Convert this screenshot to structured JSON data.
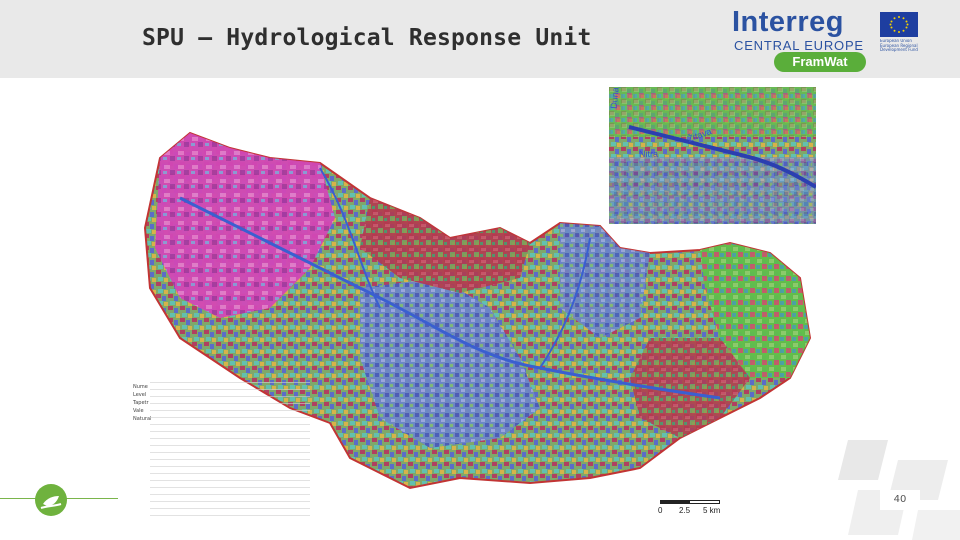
{
  "slide": {
    "title": "SPU – Hydrological Response Unit",
    "page_number": "40"
  },
  "logo": {
    "brand": "Interreg",
    "region": "CENTRAL EUROPE",
    "project": "FramWat",
    "fund_text": "European Union European Regional Development Fund"
  },
  "inset_labels": [
    "Dunaj",
    "Žitava",
    "Nitra"
  ],
  "legend_head": [
    "Nume",
    "Level",
    "Tapetr",
    "Vale",
    "Natural"
  ],
  "scale": {
    "ticks": [
      "0",
      "2.5",
      "5 km"
    ]
  },
  "colors": {
    "header_bg": "#e9e9e9",
    "brand_blue": "#2b52a1",
    "project_green": "#5aae3a",
    "map_magenta": "#d946b8",
    "map_red": "#b0304a",
    "map_blue": "#5a66c8",
    "map_green": "#5fbf4a",
    "map_teal": "#44a8a0"
  }
}
